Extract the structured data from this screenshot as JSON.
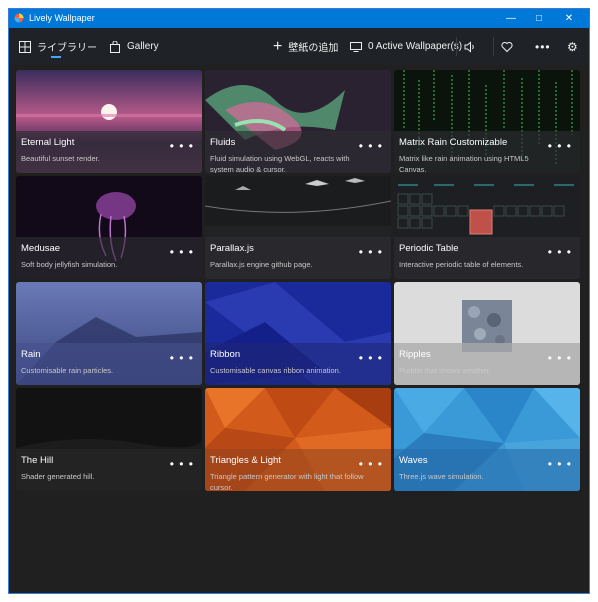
{
  "window": {
    "title": "Lively Wallpaper"
  },
  "nav": {
    "library": "ライブラリー",
    "gallery": "Gallery",
    "add": "壁紙の追加",
    "active": "0 Active Wallpaper(s)"
  },
  "cards": [
    {
      "title": "Eternal Light",
      "desc": "Beautiful sunset render."
    },
    {
      "title": "Fluids",
      "desc": "Fluid simulation using WebGL, reacts with system audio & cursor."
    },
    {
      "title": "Matrix Rain Customizable",
      "desc": "Matrix like rain animation using HTML5 Canvas."
    },
    {
      "title": "Medusae",
      "desc": "Soft body jellyfish simulation."
    },
    {
      "title": "Parallax.js",
      "desc": "Parallax.js engine github page."
    },
    {
      "title": "Periodic Table",
      "desc": "Interactive periodic table of elements."
    },
    {
      "title": "Rain",
      "desc": "Customisable rain particles."
    },
    {
      "title": "Ribbon",
      "desc": "Customisable canvas ribbon animation."
    },
    {
      "title": "Ripples",
      "desc": "Puddle that shows weather."
    },
    {
      "title": "The Hill",
      "desc": "Shader generated hill."
    },
    {
      "title": "Triangles & Light",
      "desc": "Triangle pattern generator with light that follow cursor."
    },
    {
      "title": "Waves",
      "desc": "Three.js wave simulation."
    }
  ],
  "more_label": "• • •"
}
